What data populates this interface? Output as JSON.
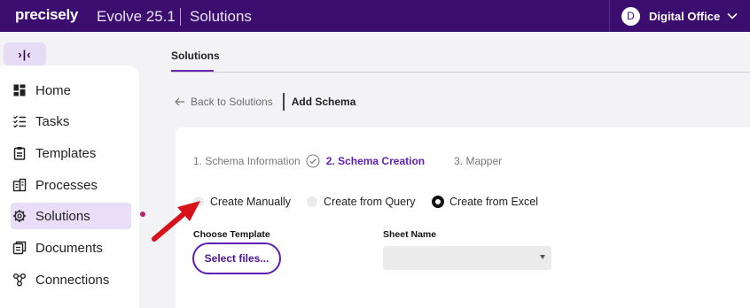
{
  "topbar": {
    "logo": "precisely",
    "product": "Evolve 25.1",
    "section": "Solutions",
    "user_initial": "D",
    "user_name": "Digital Office"
  },
  "sidebar": {
    "collapse_label": "›|‹",
    "items": [
      {
        "label": "Home",
        "icon": "home-icon"
      },
      {
        "label": "Tasks",
        "icon": "tasks-icon"
      },
      {
        "label": "Templates",
        "icon": "templates-icon"
      },
      {
        "label": "Processes",
        "icon": "processes-icon"
      },
      {
        "label": "Solutions",
        "icon": "solutions-icon",
        "active": true
      },
      {
        "label": "Documents",
        "icon": "documents-icon"
      },
      {
        "label": "Connections",
        "icon": "connections-icon"
      }
    ]
  },
  "main": {
    "tab": "Solutions",
    "back_label": "Back to Solutions",
    "current_page": "Add Schema",
    "steps": {
      "step1": "1. Schema Information",
      "step2": "2. Schema Creation",
      "step3": "3. Mapper"
    },
    "radios": {
      "manual": "Create Manually",
      "query": "Create from Query",
      "excel": "Create from Excel",
      "selected": "Create from Excel"
    },
    "choose_template_label": "Choose Template",
    "select_files_label": "Select files...",
    "sheet_name_label": "Sheet Name",
    "sheet_name_value": ""
  },
  "colors": {
    "topbar": "#3b0d6e",
    "accent": "#5e1eb3",
    "active_nav": "#e9ddf8",
    "annotation_arrow": "#d8121b"
  }
}
